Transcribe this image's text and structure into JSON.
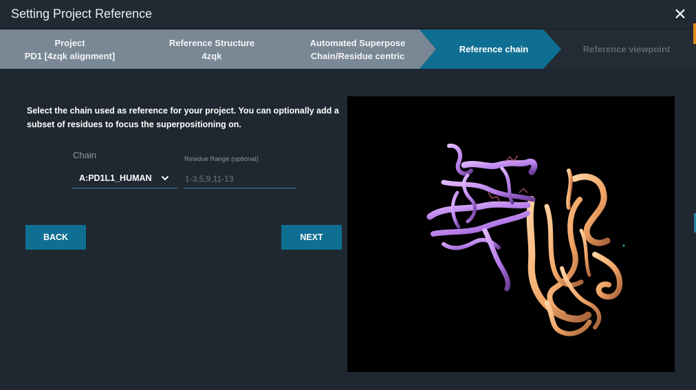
{
  "window": {
    "title": "Setting Project Reference"
  },
  "steps": [
    {
      "title": "Project",
      "subtitle": "PD1 [4zqk alignment]",
      "state": "done"
    },
    {
      "title": "Reference Structure",
      "subtitle": "4zqk",
      "state": "done"
    },
    {
      "title": "Automated Superpose",
      "subtitle": "Chain/Residue centric",
      "state": "done"
    },
    {
      "title": "Reference chain",
      "subtitle": "",
      "state": "active"
    },
    {
      "title": "Reference viewpoint",
      "subtitle": "",
      "state": "pending"
    }
  ],
  "main": {
    "instructions": "Select the chain used as reference for your project. You can optionally add a subset of residues to focus the superpositioning on.",
    "chain": {
      "label": "Chain",
      "value": "A:PD1L1_HUMAN"
    },
    "range": {
      "label": "Residue Range (optional)",
      "placeholder": "1-3,5,9,11-13",
      "value": ""
    },
    "back_label": "BACK",
    "next_label": "NEXT"
  },
  "colors": {
    "step_done": "#7a8794",
    "step_active": "#0f6f93",
    "chain_a": "#c793f2",
    "chain_b": "#f6ad72"
  }
}
